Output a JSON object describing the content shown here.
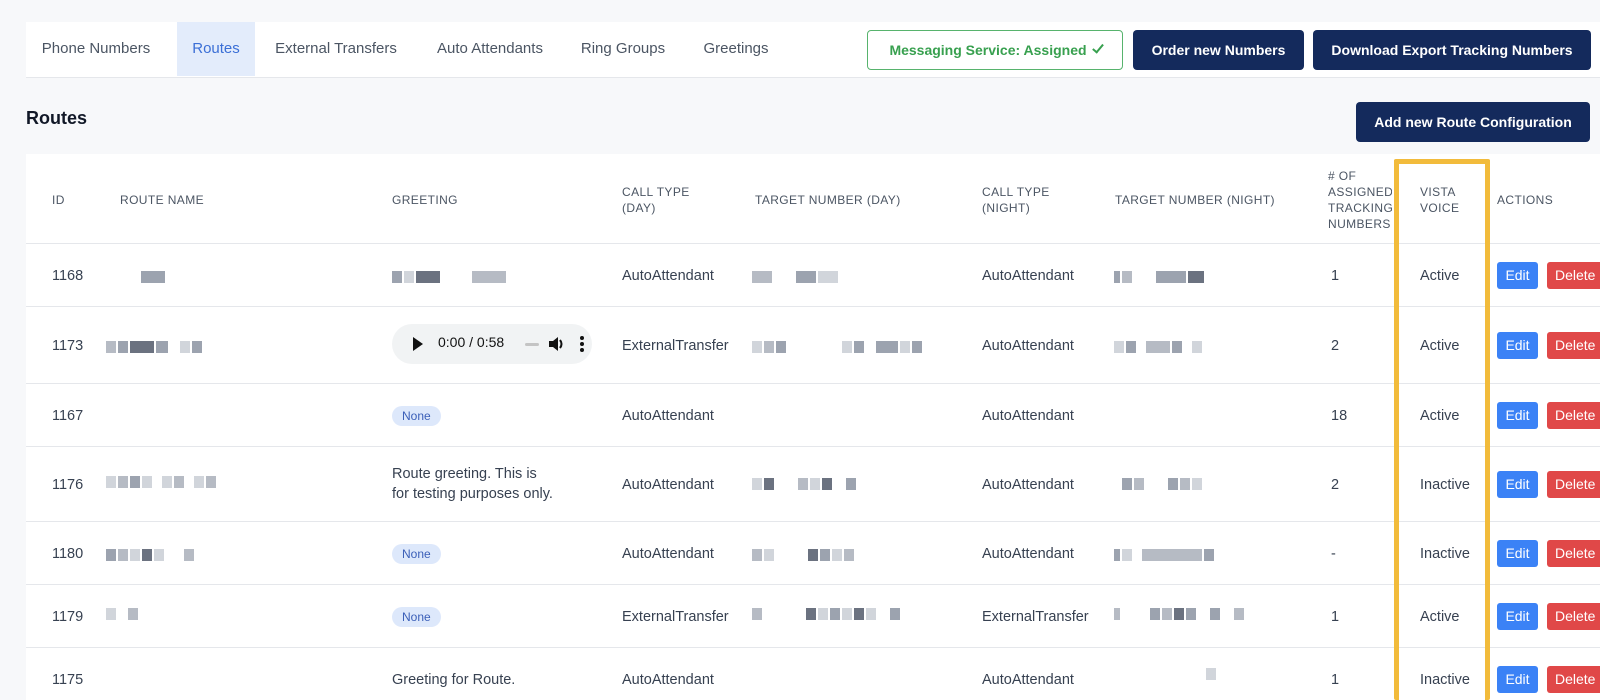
{
  "tabs": [
    {
      "label": "Phone Numbers",
      "active": false
    },
    {
      "label": "Routes",
      "active": true
    },
    {
      "label": "External Transfers",
      "active": false
    },
    {
      "label": "Auto Attendants",
      "active": false
    },
    {
      "label": "Ring Groups",
      "active": false
    },
    {
      "label": "Greetings",
      "active": false
    }
  ],
  "header": {
    "messaging_label": "Messaging Service: Assigned",
    "order_label": "Order new Numbers",
    "download_label": "Download Export Tracking Numbers"
  },
  "page": {
    "title": "Routes",
    "add_route_label": "Add new Route Configuration"
  },
  "table": {
    "columns": {
      "id": "ID",
      "route_name": "ROUTE NAME",
      "greeting": "GREETING",
      "call_type_day": [
        "CALL TYPE",
        "(DAY)"
      ],
      "target_day": "TARGET NUMBER (DAY)",
      "call_type_night": [
        "CALL TYPE",
        "(NIGHT)"
      ],
      "target_night": "TARGET NUMBER (NIGHT)",
      "assigned": [
        "# OF",
        "ASSIGNED",
        "TRACKING",
        "NUMBERS"
      ],
      "vista_voice": [
        "VISTA",
        "VOICE"
      ],
      "actions": "ACTIONS"
    },
    "rows": [
      {
        "id": "1168",
        "greeting_type": "redacted",
        "greeting": "",
        "call_type_day": "AutoAttendant",
        "call_type_night": "AutoAttendant",
        "assigned": "1",
        "vista_voice": "Active"
      },
      {
        "id": "1173",
        "greeting_type": "audio",
        "greeting": "0:00 / 0:58",
        "call_type_day": "ExternalTransfer",
        "call_type_night": "AutoAttendant",
        "assigned": "2",
        "vista_voice": "Active"
      },
      {
        "id": "1167",
        "greeting_type": "badge",
        "greeting": "None",
        "call_type_day": "AutoAttendant",
        "call_type_night": "AutoAttendant",
        "assigned": "18",
        "vista_voice": "Active"
      },
      {
        "id": "1176",
        "greeting_type": "text",
        "greeting": "Route greeting. This is",
        "greeting2": "for testing purposes only.",
        "call_type_day": "AutoAttendant",
        "call_type_night": "AutoAttendant",
        "assigned": "2",
        "vista_voice": "Inactive"
      },
      {
        "id": "1180",
        "greeting_type": "badge",
        "greeting": "None",
        "call_type_day": "AutoAttendant",
        "call_type_night": "AutoAttendant",
        "assigned": "-",
        "vista_voice": "Inactive"
      },
      {
        "id": "1179",
        "greeting_type": "badge",
        "greeting": "None",
        "call_type_day": "ExternalTransfer",
        "call_type_night": "ExternalTransfer",
        "assigned": "1",
        "vista_voice": "Active"
      },
      {
        "id": "1175",
        "greeting_type": "text",
        "greeting": "Greeting for Route.",
        "call_type_day": "AutoAttendant",
        "call_type_night": "AutoAttendant",
        "assigned": "1",
        "vista_voice": "Inactive"
      }
    ],
    "edit_label": "Edit",
    "delete_label": "Delete"
  },
  "colors": {
    "primary_dark": "#142a5c",
    "tab_active_bg": "#e3ecfb",
    "success": "#38a04f",
    "edit": "#3b82f6",
    "delete": "#e04848",
    "highlight": "#f2bb3b"
  }
}
